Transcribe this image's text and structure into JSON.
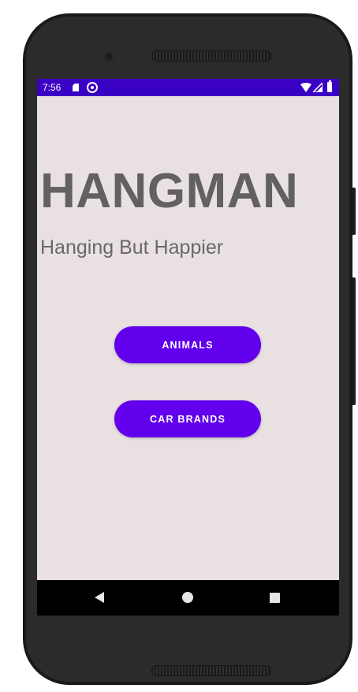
{
  "status_bar": {
    "time": "7:56",
    "icons": [
      "sd-card-icon",
      "sync-icon",
      "wifi-icon",
      "cell-signal-icon",
      "battery-icon"
    ],
    "background_color": "#3a00c4"
  },
  "app": {
    "title": "HANGMAN",
    "subtitle": "Hanging But Happier",
    "background_color": "#e8e0e1",
    "buttons": {
      "animals_label": "ANIMALS",
      "car_brands_label": "CAR BRANDS"
    },
    "accent_color": "#6200ee"
  },
  "nav_bar": {
    "icons": [
      "back-icon",
      "home-icon",
      "recents-icon"
    ]
  }
}
